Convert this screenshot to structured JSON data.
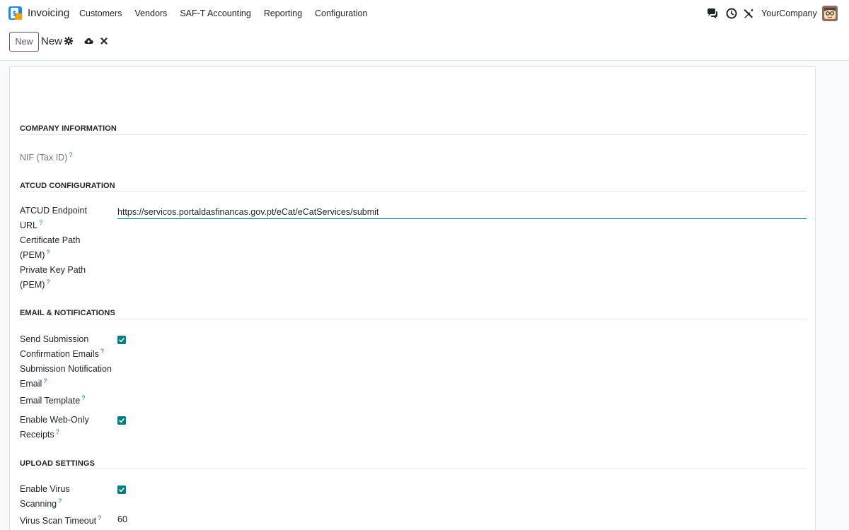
{
  "navbar": {
    "app_name": "Invoicing",
    "menu": [
      "Customers",
      "Vendors",
      "SAF-T Accounting",
      "Reporting",
      "Configuration"
    ],
    "company": "YourCompany"
  },
  "control": {
    "new_button": "New",
    "breadcrumb": "New"
  },
  "form": {
    "sections": {
      "company": "COMPANY INFORMATION",
      "atcud": "ATCUD CONFIGURATION",
      "email": "EMAIL & NOTIFICATIONS",
      "upload": "UPLOAD SETTINGS"
    },
    "help_mark": "?",
    "fields": {
      "nif_label": "NIF (Tax ID)",
      "endpoint_label_1": "ATCUD Endpoint",
      "endpoint_label_2": "URL",
      "endpoint_value": "https://servicos.portaldasfinancas.gov.pt/eCat/eCatServices/submit",
      "cert_label_1": "Certificate Path",
      "cert_label_2": "(PEM)",
      "key_label_1": "Private Key Path",
      "key_label_2": "(PEM)",
      "send_conf_label_1": "Send Submission",
      "send_conf_label_2": "Confirmation Emails",
      "send_conf_checked": true,
      "notif_email_label_1": "Submission Notification",
      "notif_email_label_2": "Email",
      "template_label": "Email Template",
      "web_only_label_1": "Enable Web-Only",
      "web_only_label_2": "Receipts",
      "web_only_checked": true,
      "virus_label_1": "Enable Virus",
      "virus_label_2": "Scanning",
      "virus_checked": true,
      "timeout_label": "Virus Scan Timeout",
      "timeout_value": "60"
    }
  },
  "colors": {
    "accent": "#017e84",
    "brand": "#714b67"
  }
}
